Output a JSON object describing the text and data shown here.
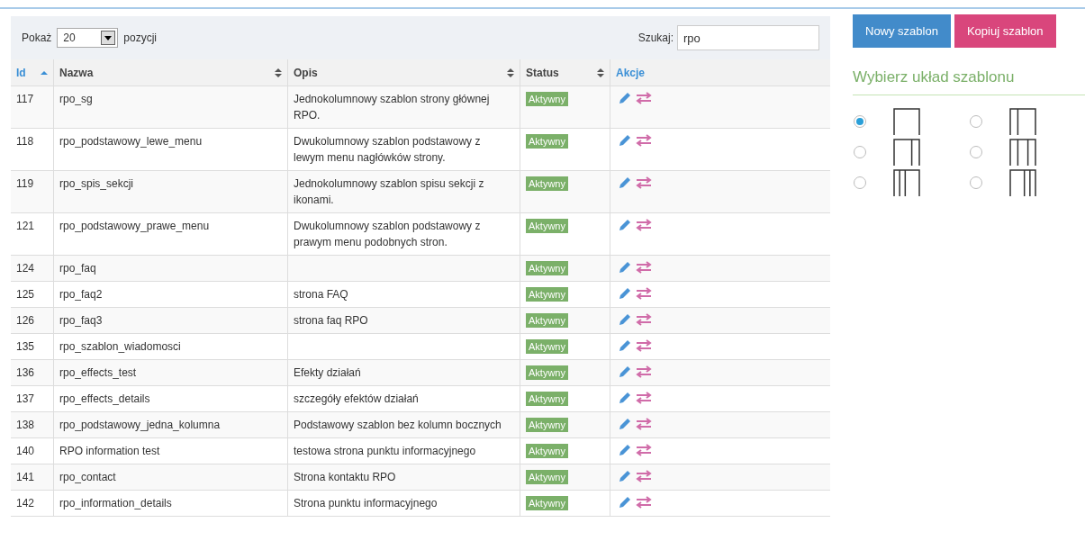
{
  "table_controls": {
    "show_label": "Pokaż",
    "page_size": "20",
    "show_suffix": "pozycji",
    "search_label": "Szukaj:",
    "search_value": "rpo"
  },
  "columns": [
    {
      "label": "Id",
      "sorted": true,
      "sortable": true,
      "kind": "link"
    },
    {
      "label": "Nazwa",
      "sorted": false,
      "sortable": true,
      "kind": "plain"
    },
    {
      "label": "Opis",
      "sorted": false,
      "sortable": true,
      "kind": "plain"
    },
    {
      "label": "Status",
      "sorted": false,
      "sortable": true,
      "kind": "plain"
    },
    {
      "label": "Akcje",
      "sorted": false,
      "sortable": false,
      "kind": "link"
    }
  ],
  "rows": [
    {
      "id": "117",
      "name": "rpo_sg",
      "description": "Jednokolumnowy szablon strony głównej RPO.",
      "status": "Aktywny"
    },
    {
      "id": "118",
      "name": "rpo_podstawowy_lewe_menu",
      "description": "Dwukolumnowy szablon podstawowy z lewym menu nagłówków strony.",
      "status": "Aktywny"
    },
    {
      "id": "119",
      "name": "rpo_spis_sekcji",
      "description": "Jednokolumnowy szablon spisu sekcji z ikonami.",
      "status": "Aktywny"
    },
    {
      "id": "121",
      "name": "rpo_podstawowy_prawe_menu",
      "description": "Dwukolumnowy szablon podstawowy z prawym menu podobnych stron.",
      "status": "Aktywny"
    },
    {
      "id": "124",
      "name": "rpo_faq",
      "status": "Aktywny"
    },
    {
      "id": "125",
      "name": "rpo_faq2",
      "description": "strona FAQ",
      "status": "Aktywny"
    },
    {
      "id": "126",
      "name": "rpo_faq3",
      "description": "strona faq RPO",
      "status": "Aktywny"
    },
    {
      "id": "135",
      "name": "rpo_szablon_wiadomosci",
      "status": "Aktywny"
    },
    {
      "id": "136",
      "name": "rpo_effects_test",
      "description": "Efekty działań",
      "status": "Aktywny"
    },
    {
      "id": "137",
      "name": "rpo_effects_details",
      "description": "szczegóły efektów działań",
      "status": "Aktywny"
    },
    {
      "id": "138",
      "name": "rpo_podstawowy_jedna_kolumna",
      "description": "Podstawowy szablon bez kolumn bocznych",
      "status": "Aktywny"
    },
    {
      "id": "140",
      "name": "RPO information test",
      "description": "testowa strona punktu informacyjnego",
      "status": "Aktywny"
    },
    {
      "id": "141",
      "name": "rpo_contact",
      "description": "Strona kontaktu RPO",
      "status": "Aktywny"
    },
    {
      "id": "142",
      "name": "rpo_information_details",
      "description": "Strona punktu informacyjnego",
      "status": "Aktywny"
    }
  ],
  "buttons": [
    {
      "label": "Nowy szablon",
      "kind": "primary"
    },
    {
      "label": "Kopiuj szablon",
      "kind": "secondary"
    }
  ],
  "layout_section": {
    "title": "Wybierz układ szablonu"
  },
  "layouts": [
    {
      "kind": "single",
      "selected": true
    },
    {
      "kind": "left",
      "selected": false
    },
    {
      "kind": "right",
      "selected": false
    },
    {
      "kind": "both",
      "selected": false
    },
    {
      "kind": "left2",
      "selected": false
    },
    {
      "kind": "right2",
      "selected": false
    }
  ]
}
